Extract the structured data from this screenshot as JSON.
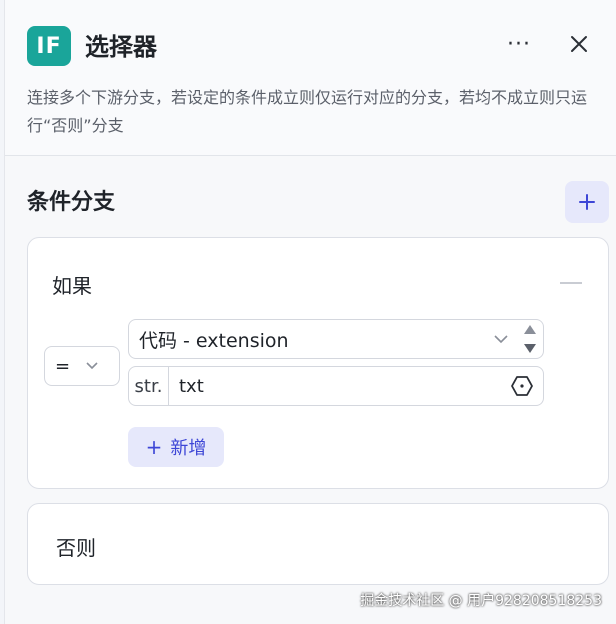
{
  "header": {
    "icon_label": "IF",
    "title": "选择器",
    "more_label": "···",
    "description": "连接多个下游分支，若设定的条件成立则仅运行对应的分支，若均不成立则只运行“否则”分支"
  },
  "section": {
    "title": "条件分支",
    "add_label": "+"
  },
  "branch_if": {
    "label": "如果",
    "condition": {
      "operator": "=",
      "variable": "代码 - extension",
      "value_type": "str.",
      "value": "txt"
    },
    "add_label": "新增",
    "add_plus": "+"
  },
  "branch_else": {
    "label": "否则"
  },
  "watermark": "掘金技术社区 @ 用户928208518253",
  "colors": {
    "icon_bg": "#1aa59a",
    "accent": "#3d46d6",
    "accent_bg": "#e6e8fb"
  }
}
